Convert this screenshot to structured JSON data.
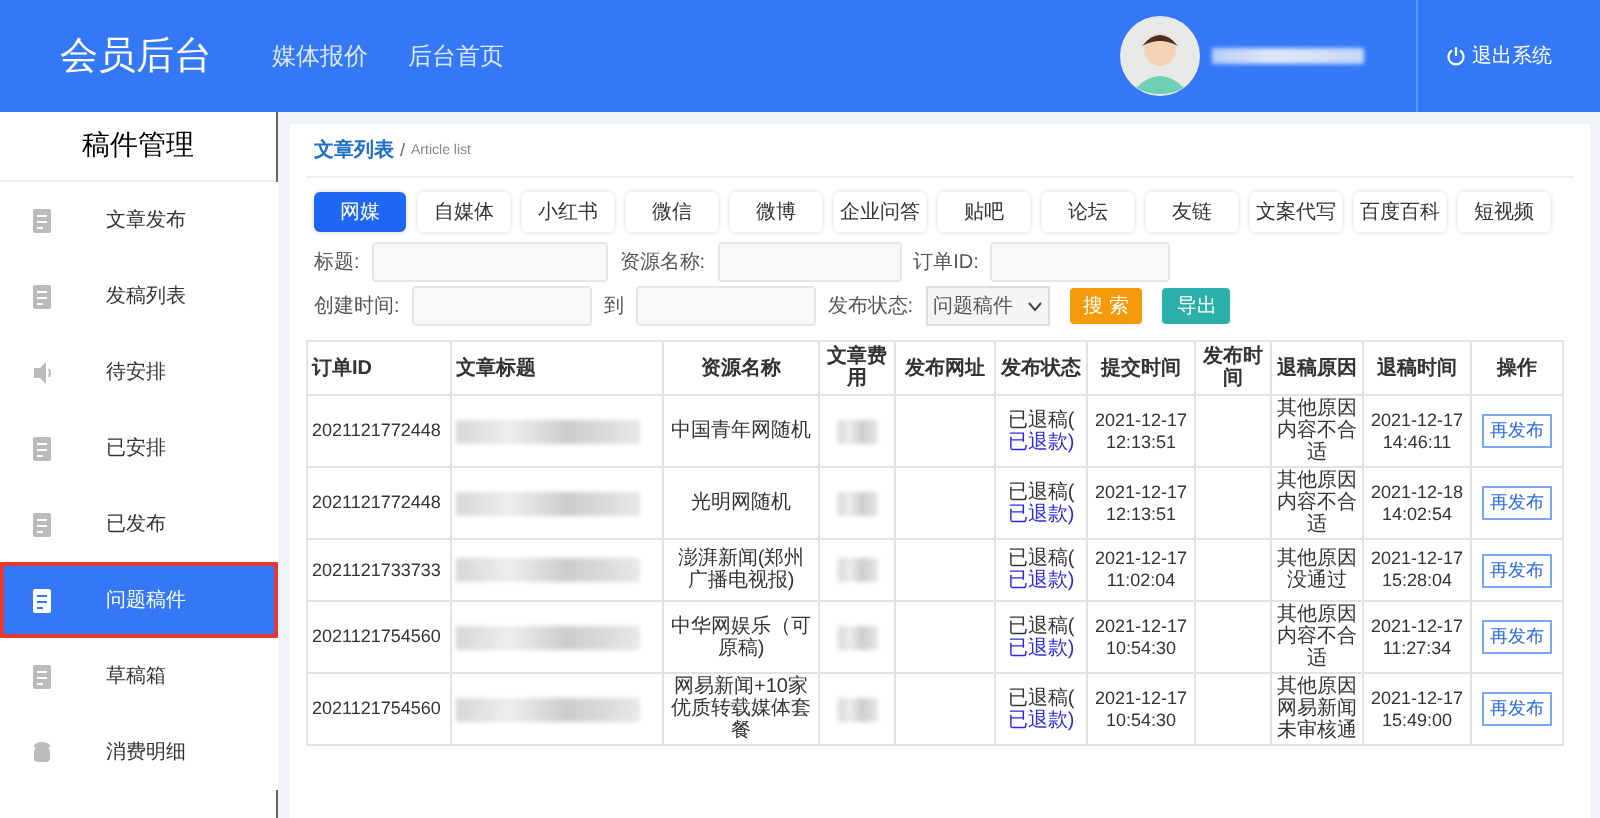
{
  "header": {
    "logo": "会员后台",
    "nav": [
      {
        "label": "媒体报价"
      },
      {
        "label": "后台首页"
      }
    ],
    "logout": "退出系统"
  },
  "sidebar": {
    "title": "稿件管理",
    "items": [
      {
        "label": "文章发布",
        "selected": false
      },
      {
        "label": "发稿列表",
        "selected": false
      },
      {
        "label": "待安排",
        "selected": false
      },
      {
        "label": "已安排",
        "selected": false
      },
      {
        "label": "已发布",
        "selected": false
      },
      {
        "label": "问题稿件",
        "selected": true
      },
      {
        "label": "草稿箱",
        "selected": false
      },
      {
        "label": "消费明细",
        "selected": false
      }
    ]
  },
  "breadcrumb": {
    "title": "文章列表",
    "separator": "/",
    "subtitle": "Article list"
  },
  "tabs": [
    {
      "label": "网媒",
      "selected": true
    },
    {
      "label": "自媒体",
      "selected": false
    },
    {
      "label": "小红书",
      "selected": false
    },
    {
      "label": "微信",
      "selected": false
    },
    {
      "label": "微博",
      "selected": false
    },
    {
      "label": "企业问答",
      "selected": false
    },
    {
      "label": "贴吧",
      "selected": false
    },
    {
      "label": "论坛",
      "selected": false
    },
    {
      "label": "友链",
      "selected": false
    },
    {
      "label": "文案代写",
      "selected": false
    },
    {
      "label": "百度百科",
      "selected": false
    },
    {
      "label": "短视频",
      "selected": false
    }
  ],
  "filters": {
    "title_label": "标题:",
    "resource_label": "资源名称:",
    "order_label": "订单ID:",
    "created_label": "创建时间:",
    "to_label": "到",
    "status_label": "发布状态:",
    "status_value": "问题稿件",
    "search_button": "搜 索",
    "export_button": "导出"
  },
  "table": {
    "columns": [
      "订单ID",
      "文章标题",
      "资源名称",
      "文章费用",
      "发布网址",
      "发布状态",
      "提交时间",
      "发布时间",
      "退稿原因",
      "退稿时间",
      "操作"
    ],
    "rows": [
      {
        "order_id": "2021121772448",
        "resource": "中国青年网随机",
        "status": "已退稿(",
        "refund": "已退款)",
        "submitted": "2021-12-17 12:13:51",
        "reason": "其他原因内容不合适",
        "rejected": "2021-12-17 14:46:11",
        "action": "再发布"
      },
      {
        "order_id": "2021121772448",
        "resource": "光明网随机",
        "status": "已退稿(",
        "refund": "已退款)",
        "submitted": "2021-12-17 12:13:51",
        "reason": "其他原因内容不合适",
        "rejected": "2021-12-18 14:02:54",
        "action": "再发布"
      },
      {
        "order_id": "2021121733733",
        "resource": "澎湃新闻(郑州广播电视报)",
        "status": "已退稿(",
        "refund": "已退款)",
        "submitted": "2021-12-17 11:02:04",
        "reason": "其他原因没通过",
        "rejected": "2021-12-17 15:28:04",
        "action": "再发布"
      },
      {
        "order_id": "2021121754560",
        "resource": "中华网娱乐（可原稿)",
        "status": "已退稿(",
        "refund": "已退款)",
        "submitted": "2021-12-17 10:54:30",
        "reason": "其他原因内容不合适",
        "rejected": "2021-12-17 11:27:34",
        "action": "再发布"
      },
      {
        "order_id": "2021121754560",
        "resource": "网易新闻+10家优质转载媒体套餐",
        "status": "已退稿(",
        "refund": "已退款)",
        "submitted": "2021-12-17 10:54:30",
        "reason": "其他原因网易新闻未审核通",
        "rejected": "2021-12-17 15:49:00",
        "action": "再发布"
      }
    ]
  }
}
